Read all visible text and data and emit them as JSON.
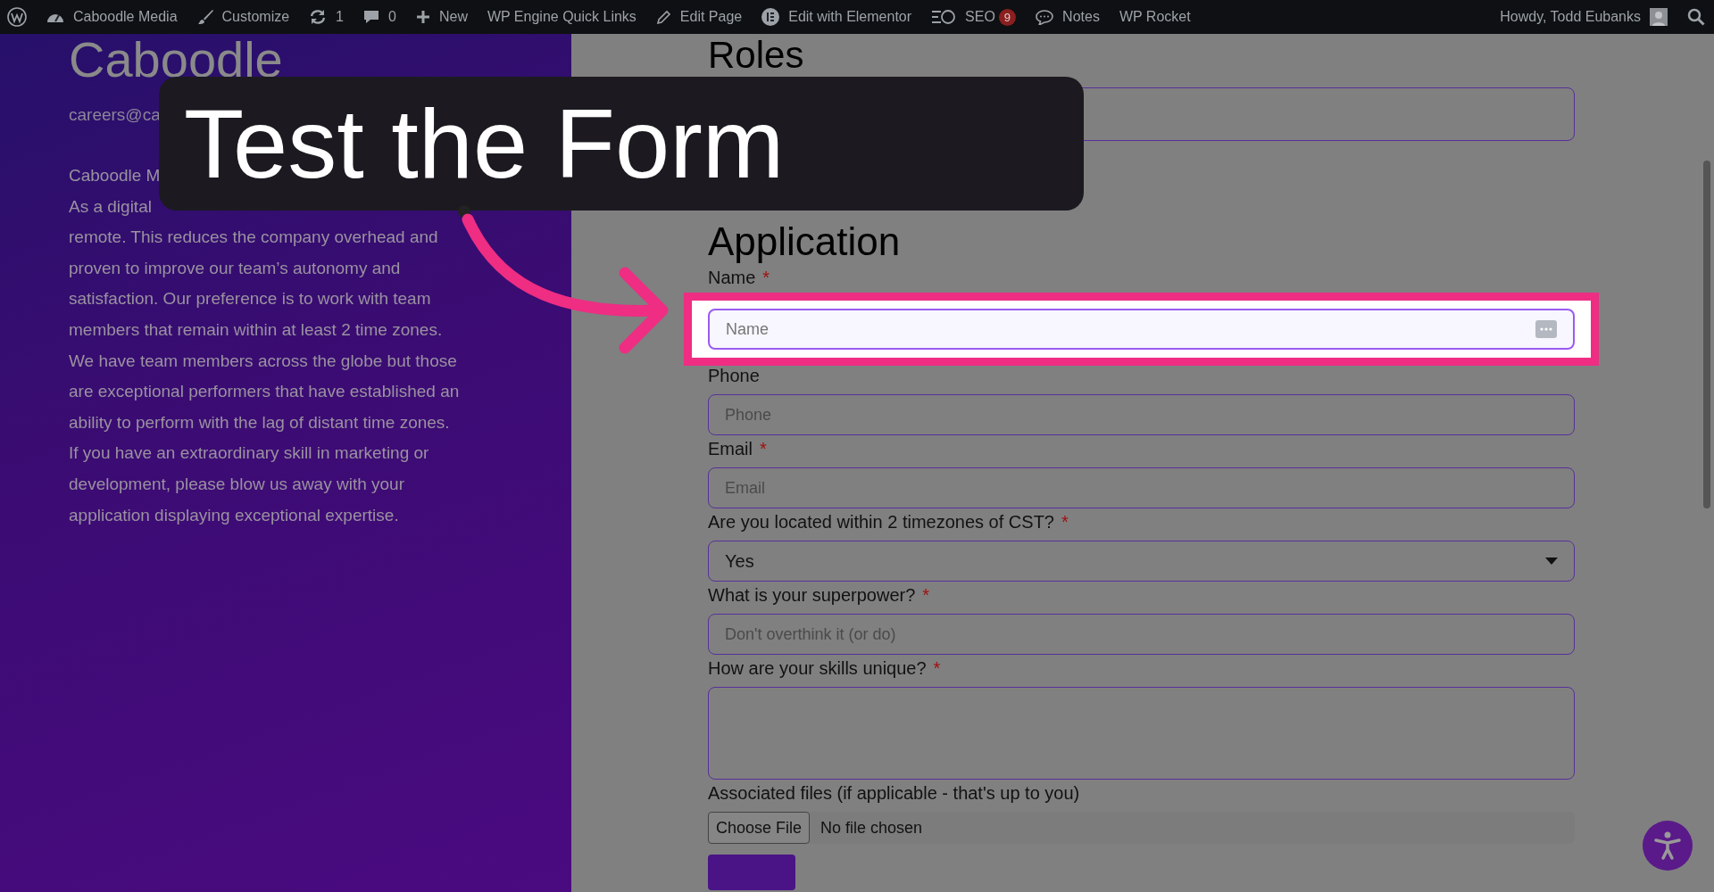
{
  "admin_bar": {
    "items": [
      {
        "label": "Caboodle Media"
      },
      {
        "label": "Customize"
      },
      {
        "label": "1"
      },
      {
        "label": "0"
      },
      {
        "label": "New"
      },
      {
        "label": "WP Engine Quick Links"
      },
      {
        "label": "Edit Page"
      },
      {
        "label": "Edit with Elementor"
      },
      {
        "label": "SEO",
        "badge": "9"
      },
      {
        "label": "Notes"
      },
      {
        "label": "WP Rocket"
      }
    ],
    "greeting": "Howdy, Todd Eubanks"
  },
  "sidebar": {
    "title": "Caboodle",
    "email": "careers@ca",
    "paragraph_lines": [
      "Caboodle M",
      "As a digital",
      "remote. This reduces the company overhead and",
      "proven to improve our team’s autonomy and",
      "satisfaction. Our preference is to work with team",
      "members that remain within at least 2 time zones.",
      "We have team members across the globe but those",
      "are exceptional performers that have established an",
      "ability to perform with the lag of distant time zones.",
      "If you have an extraordinary skill in marketing or",
      "development, please blow us away with your",
      "application displaying exceptional expertise."
    ]
  },
  "form": {
    "roles_heading": "Roles",
    "application_heading": "Application",
    "fields": [
      {
        "kind": "text",
        "label": "Name",
        "required_mark": "*",
        "placeholder": "Name",
        "highlighted": true
      },
      {
        "kind": "text",
        "label": "Phone",
        "placeholder": "Phone",
        "highlighted": false
      },
      {
        "kind": "text",
        "label": "Email",
        "required_mark": "*",
        "placeholder": "Email",
        "highlighted": false
      },
      {
        "kind": "select",
        "label": "Are you located within 2 timezones of CST?",
        "required_mark": "*",
        "value": "Yes",
        "highlighted": false
      },
      {
        "kind": "text",
        "label": "What is your superpower?",
        "required_mark": "*",
        "placeholder": "Don't overthink it (or do)",
        "highlighted": false
      },
      {
        "kind": "textarea",
        "label": "How are your skills unique?",
        "required_mark": "*",
        "highlighted": false
      },
      {
        "kind": "file",
        "label": "Associated files (if applicable - that's up to you)",
        "button": "Choose File",
        "status": "No file chosen",
        "highlighted": false
      }
    ]
  },
  "callout": {
    "text": "Test the Form"
  }
}
